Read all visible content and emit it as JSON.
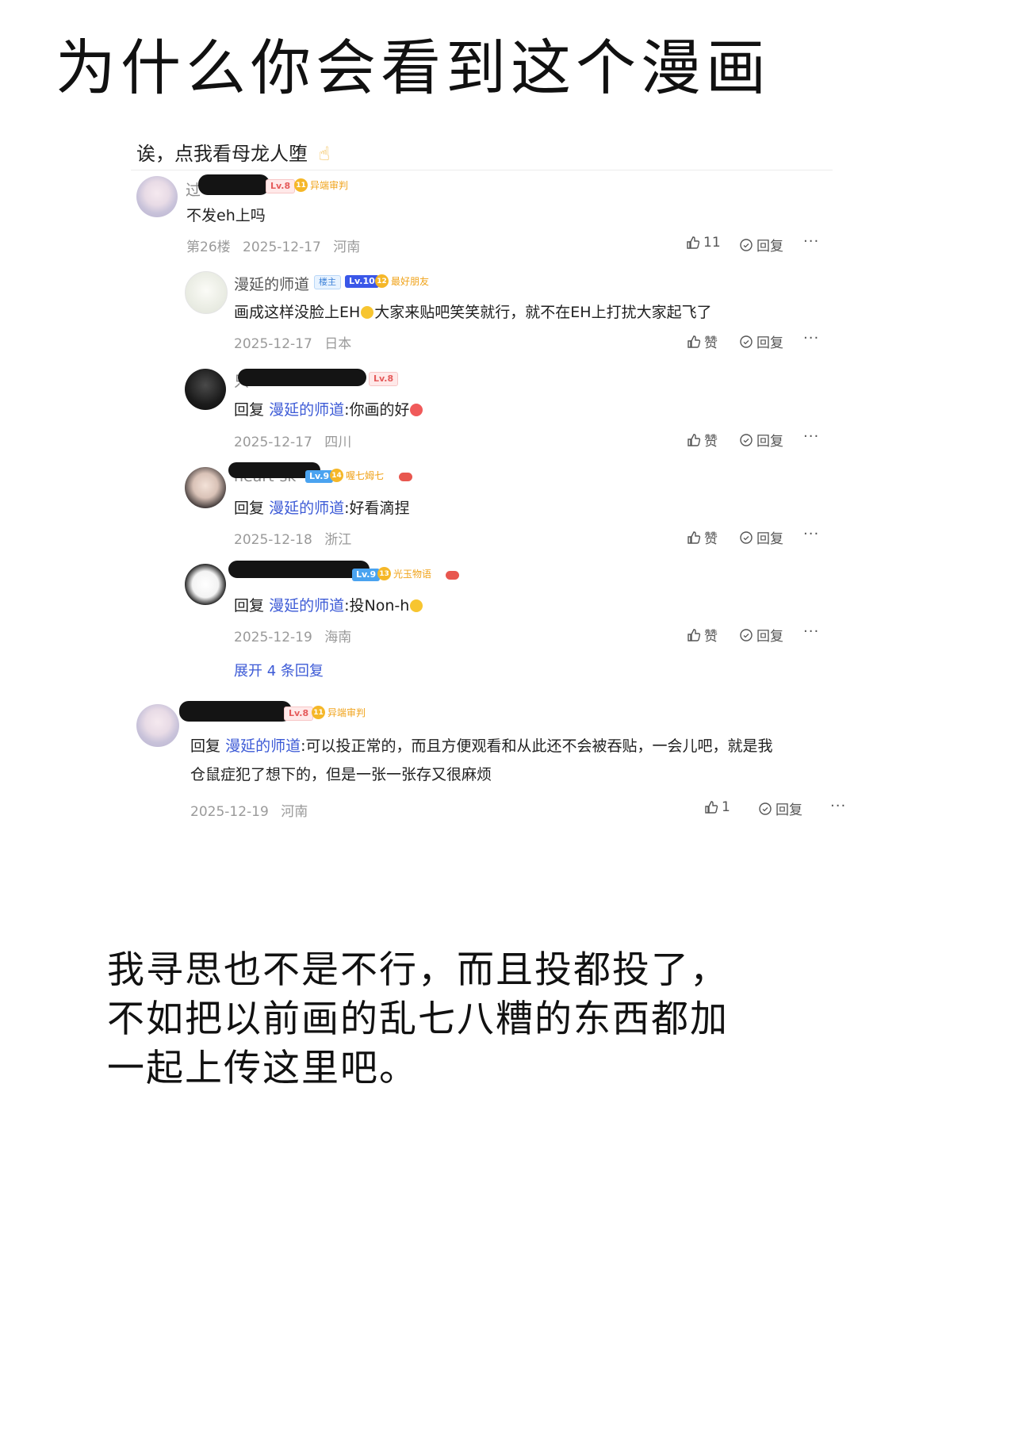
{
  "heading": "为什么你会看到这个漫画",
  "post": {
    "title": "诶，点我看母龙人堕",
    "pointing_emoji": "☝"
  },
  "comment1": {
    "username_visible": "过",
    "level": "Lv.8",
    "medal_level": "11",
    "medal_name": "异端审判",
    "text": "不发eh上吗",
    "floor": "第26楼",
    "date": "2025-12-17",
    "location": "河南",
    "likes": "11",
    "reply_label": "回复"
  },
  "replies": [
    {
      "username": "漫延的师道",
      "owner_badge": "楼主",
      "level": "Lv.10",
      "medal_level": "12",
      "medal_name": "最好朋友",
      "text_a": "画成这样没脸上EH",
      "text_b": "大家来贴吧笑笑就行，就不在EH上打扰大家起飞了",
      "date": "2025-12-17",
      "location": "日本",
      "like_label": "赞",
      "reply_label": "回复"
    },
    {
      "username_visible": "只",
      "level": "Lv.8",
      "reply_prefix": "回复",
      "reply_to": "漫延的师道",
      "text": ":你画的好",
      "date": "2025-12-17",
      "location": "四川",
      "like_label": "赞",
      "reply_label": "回复"
    },
    {
      "username_visible": "heart-sk",
      "level": "Lv.9",
      "medal_level": "14",
      "medal_name": "喔七姆七",
      "reply_prefix": "回复",
      "reply_to": "漫延的师道",
      "text": ":好看滴捏",
      "date": "2025-12-18",
      "location": "浙江",
      "like_label": "赞",
      "reply_label": "回复"
    },
    {
      "level": "Lv.9",
      "medal_level": "13",
      "medal_name": "光玉物语",
      "reply_prefix": "回复",
      "reply_to": "漫延的师道",
      "text": ":投Non-h",
      "date": "2025-12-19",
      "location": "海南",
      "like_label": "赞",
      "reply_label": "回复"
    }
  ],
  "expand_label": "展开 4 条回复",
  "comment2": {
    "level": "Lv.8",
    "medal_level": "11",
    "medal_name": "异端审判",
    "reply_prefix": "回复",
    "reply_to": "漫延的师道",
    "text_line1": ":可以投正常的，而且方便观看和从此还不会被吞贴，一会儿吧，就是我",
    "text_line2": "仓鼠症犯了想下的，但是一张一张存又很麻烦",
    "date": "2025-12-19",
    "location": "河南",
    "likes": "1",
    "reply_label": "回复"
  },
  "more_label": "···",
  "bottom_text": [
    "我寻思也不是不行，而且投都投了，",
    "不如把以前画的乱七八糟的东西都加",
    "一起上传这里吧。"
  ],
  "icons": {
    "like": "thumb-up-icon",
    "reply": "comment-icon",
    "more": "more-icon"
  }
}
